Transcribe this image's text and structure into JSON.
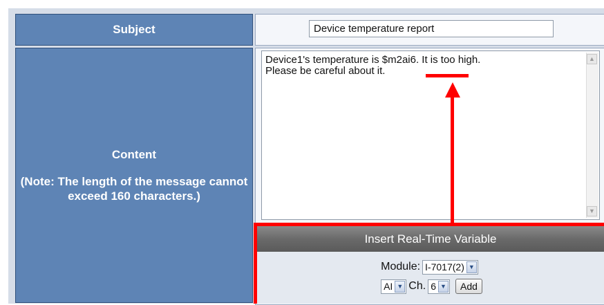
{
  "form": {
    "subject": {
      "label": "Subject",
      "value": "Device temperature report"
    },
    "content": {
      "label": "Content",
      "note": "(Note: The length of the message cannot exceed 160 characters.)",
      "message": "Device1's temperature is $m2ai6. It is too high.\nPlease be careful about it."
    }
  },
  "insert_variable": {
    "header": "Insert Real-Time Variable",
    "module_label": "Module:",
    "module_value": "I-7017(2)",
    "type_value": "AI",
    "channel_label": "Ch.",
    "channel_value": "6",
    "add_button": "Add"
  },
  "annotation": {
    "color": "#ff0000"
  }
}
